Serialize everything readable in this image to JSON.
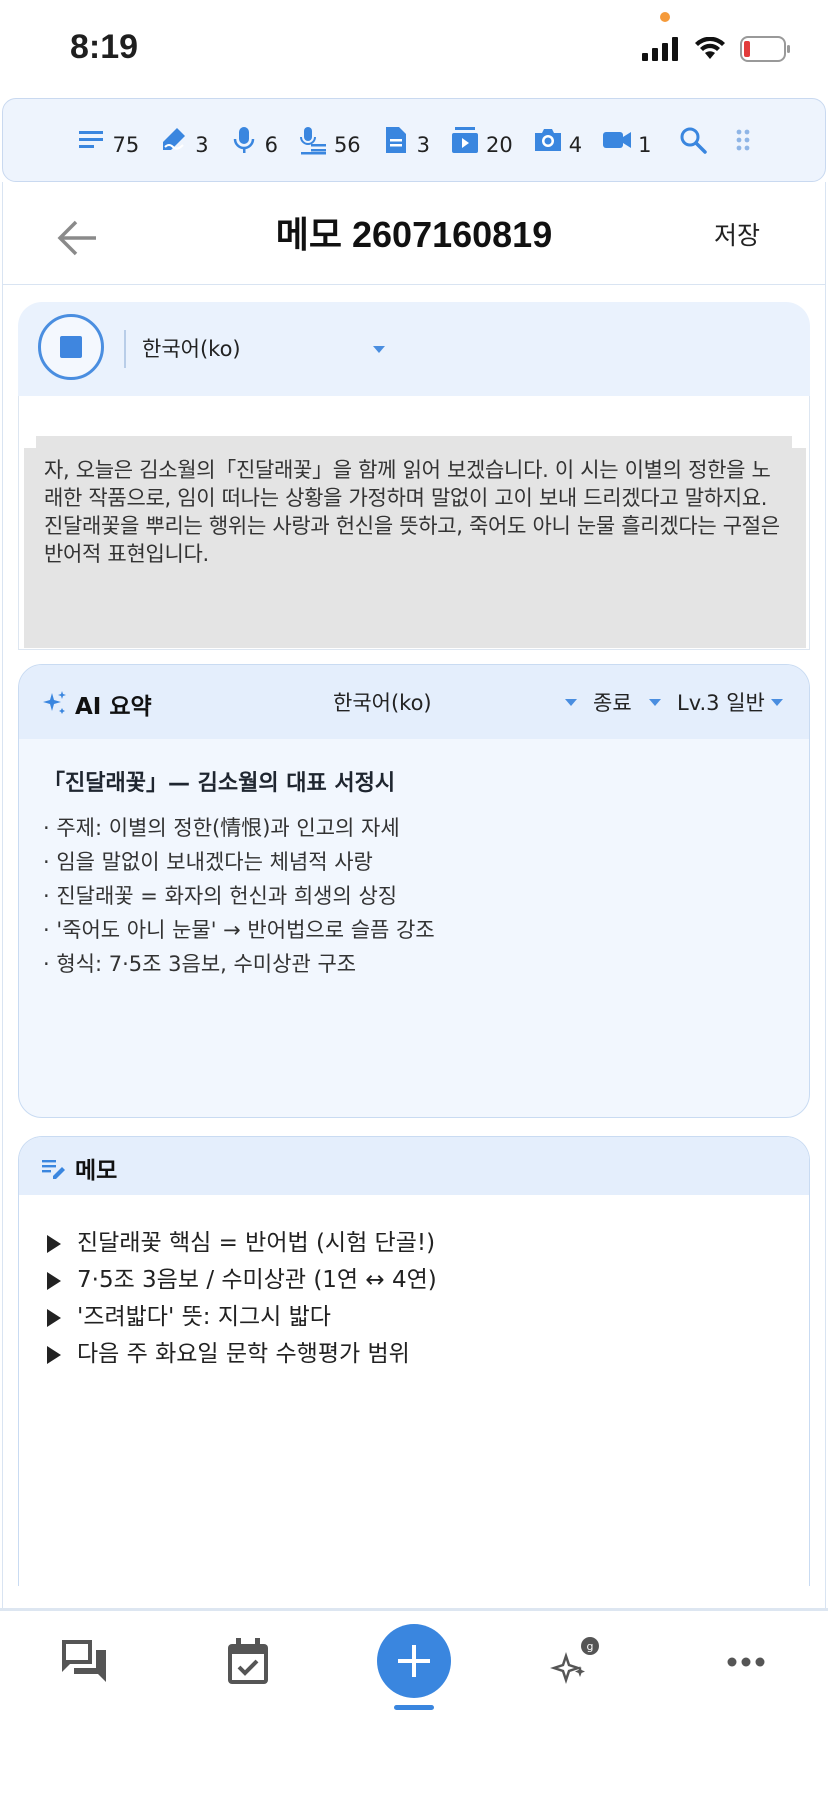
{
  "status": {
    "time": "8:19"
  },
  "counters": [
    {
      "icon": "text-lines-icon",
      "count": "75"
    },
    {
      "icon": "handwriting-icon",
      "count": "3"
    },
    {
      "icon": "microphone-icon",
      "count": "6"
    },
    {
      "icon": "transcript-mic-icon",
      "count": "56"
    },
    {
      "icon": "document-icon",
      "count": "3"
    },
    {
      "icon": "slides-icon",
      "count": "20"
    },
    {
      "icon": "camera-icon",
      "count": "4"
    },
    {
      "icon": "video-icon",
      "count": "1"
    }
  ],
  "header": {
    "title": "메모 2607160819",
    "save_label": "저장"
  },
  "recording": {
    "language": "한국어(ko)",
    "transcript": "자, 오늘은 김소월의「진달래꽃」을 함께 읽어 보겠습니다. 이 시는 이별의 정한을 노래한 작품으로, 임이 떠나는 상황을 가정하며 말없이 고이 보내 드리겠다고 말하지요. 진달래꽃을 뿌리는 행위는 사랑과 헌신을 뜻하고, 죽어도 아니 눈물 흘리겠다는 구절은 반어적 표현입니다."
  },
  "ai_summary": {
    "title": "AI 요약",
    "language": "한국어(ko)",
    "type": "종료",
    "level": "Lv.3 일반",
    "heading": "「진달래꽃」— 김소월의 대표 서정시",
    "lines": [
      "· 주제: 이별의 정한(情恨)과 인고의 자세",
      "· 임을 말없이 보내겠다는 체념적 사랑",
      "· 진달래꽃 = 화자의 헌신과 희생의 상징",
      "· '죽어도 아니 눈물' → 반어법으로 슬픔 강조",
      "· 형식: 7·5조 3음보, 수미상관 구조"
    ]
  },
  "memo": {
    "title": "메모",
    "lines": [
      "진달래꽃 핵심 = 반어법 (시험 단골!)",
      "7·5조 3음보 / 수미상관 (1연 ↔ 4연)",
      "'즈려밟다' 뜻: 지그시 밟다",
      "다음 주 화요일 문학 수행평가 범위"
    ]
  },
  "colors": {
    "accent": "#3a86df",
    "card_bg": "#eaf2fd",
    "transcript_bg": "#e4e4e4"
  }
}
